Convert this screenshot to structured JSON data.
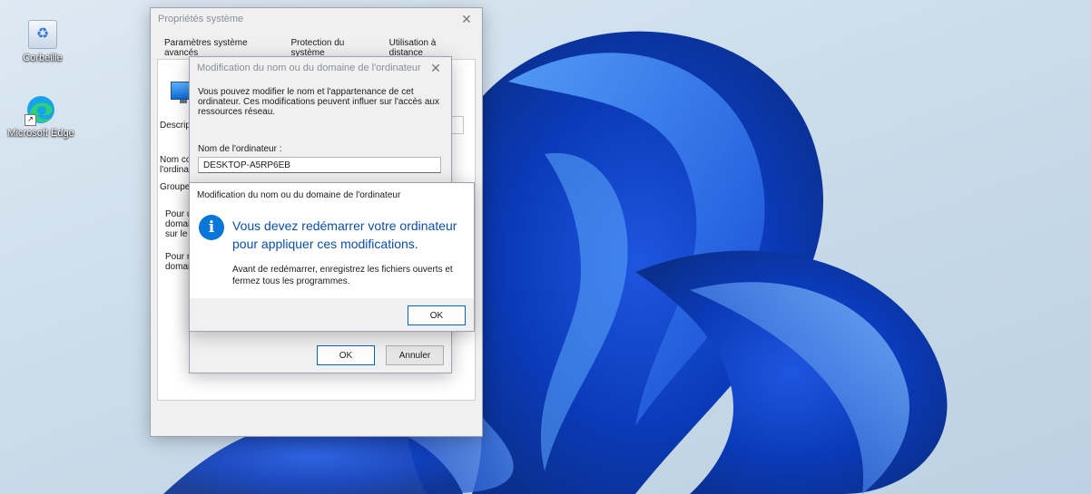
{
  "desktop": {
    "icons": [
      {
        "label": "Corbeille",
        "icon": "recycle-bin-icon"
      },
      {
        "label": "Microsoft Edge",
        "icon": "edge-icon"
      }
    ]
  },
  "sysprops": {
    "title": "Propriétés système",
    "tabs": [
      "Paramètres système avancés",
      "Protection du système",
      "Utilisation à distance"
    ],
    "frag_descr": "Descrip",
    "frag_nom1": "Nom co",
    "frag_nom2": "l'ordinat",
    "frag_groupe": "Groupe",
    "frag_pour1": [
      "Pour u",
      "domai",
      "sur le"
    ],
    "frag_pour2": [
      "Pour r",
      "domai"
    ]
  },
  "rename": {
    "title": "Modification du nom ou du domaine de l'ordinateur",
    "intro": "Vous pouvez modifier le nom et l'appartenance de cet ordinateur. Ces modifications peuvent influer sur l'accès aux ressources réseau.",
    "computer_name_label": "Nom de l'ordinateur :",
    "computer_name_value": "DESKTOP-A5RP6EB",
    "ok": "OK",
    "cancel": "Annuler"
  },
  "restart": {
    "title": "Modification du nom ou du domaine de l'ordinateur",
    "headline_1": "Vous devez redémarrer votre ordinateur",
    "headline_2": "pour appliquer ces modifications.",
    "body_1": "Avant de redémarrer, enregistrez les fichiers ouverts et",
    "body_2": "fermez tous les programmes.",
    "ok": "OK",
    "accent": "#0067c0"
  }
}
